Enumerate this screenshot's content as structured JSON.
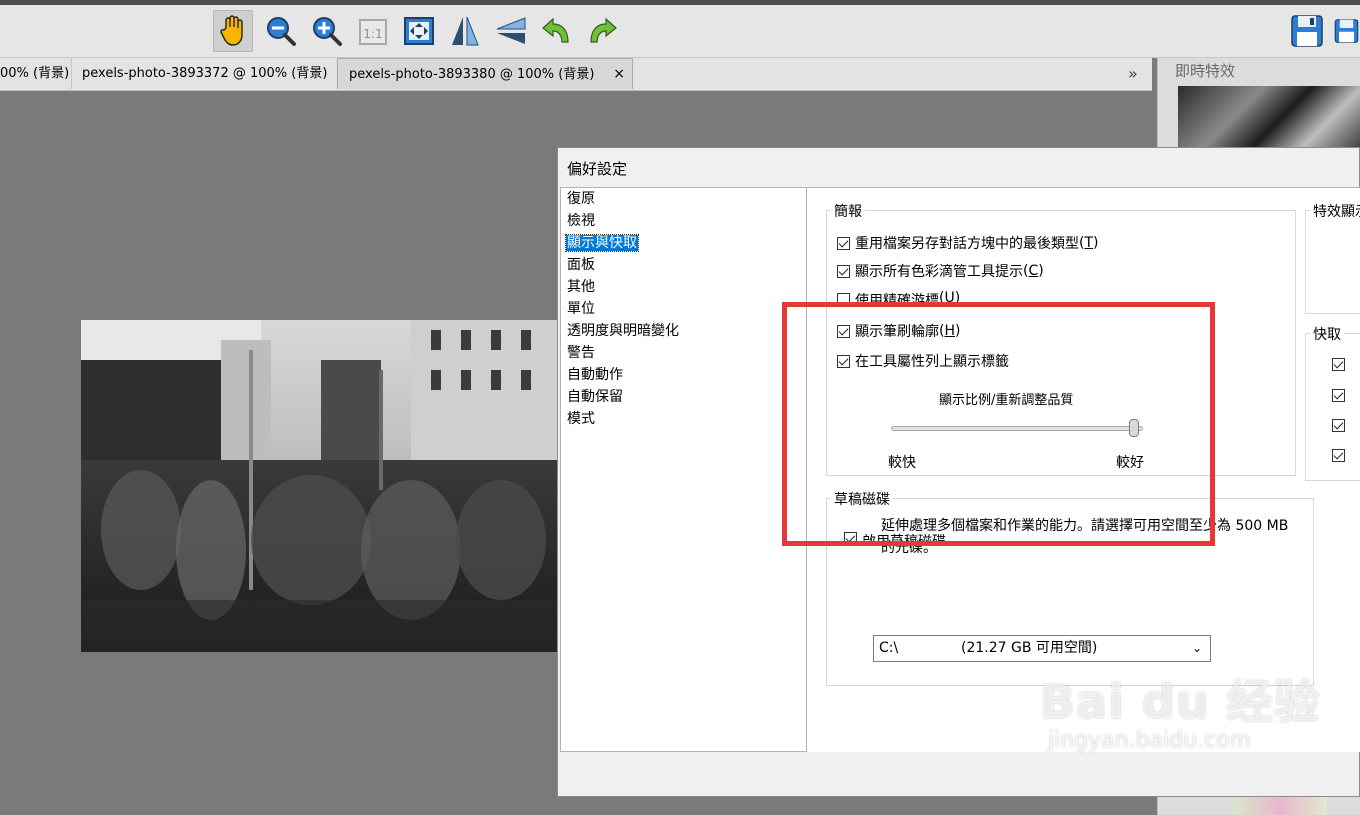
{
  "tabs": [
    {
      "label": "00% (背景)"
    },
    {
      "label": "pexels-photo-3893372 @ 100% (背景)"
    },
    {
      "label": "pexels-photo-3893380 @ 100% (背景)",
      "close": "×"
    }
  ],
  "tab_more": "»",
  "side_panel": {
    "title": "即時特效"
  },
  "dialog": {
    "title": "偏好設定",
    "categories": [
      "復原",
      "檢視",
      "顯示與快取",
      "面板",
      "其他",
      "單位",
      "透明度與明暗變化",
      "警告",
      "自動動作",
      "自動保留",
      "模式"
    ],
    "selected_category": "顯示與快取",
    "brief": {
      "title": "簡報",
      "options": [
        {
          "text": "重用檔案另存對話方塊中的最後類型",
          "key": "T",
          "checked": true
        },
        {
          "text": "顯示所有色彩滴管工具提示",
          "key": "C",
          "checked": true
        },
        {
          "text": "使用精確游標",
          "key": "U",
          "checked": false
        },
        {
          "text": "顯示筆刷輪廓",
          "key": "H",
          "checked": true
        },
        {
          "text": "在工具屬性列上顯示標籤",
          "key": "",
          "checked": true
        }
      ],
      "slider_title": "顯示比例/重新調整品質",
      "slider_min": "較快",
      "slider_max": "較好",
      "slider_value": 1.0
    },
    "scratch": {
      "title": "草稿磁碟",
      "enable": {
        "text": "啟用草稿磁碟",
        "checked": true
      },
      "description": "延伸處理多個檔案和作業的能力。請選擇可用空間至少為 500 MB 的光碟。",
      "drive": "C:\\",
      "free_space": "(21.27 GB 可用空間)"
    },
    "effects_group": {
      "title": "特效顯示"
    },
    "cache_group": {
      "title": "快取",
      "items": [
        {
          "checked": true
        },
        {
          "checked": true
        },
        {
          "checked": true
        },
        {
          "checked": true
        }
      ]
    }
  },
  "watermark": {
    "main": "Bai du 经验",
    "sub": "jingyan.baidu.com"
  },
  "colors": {
    "selection": "#0078d7",
    "highlight_border": "#e53935"
  }
}
